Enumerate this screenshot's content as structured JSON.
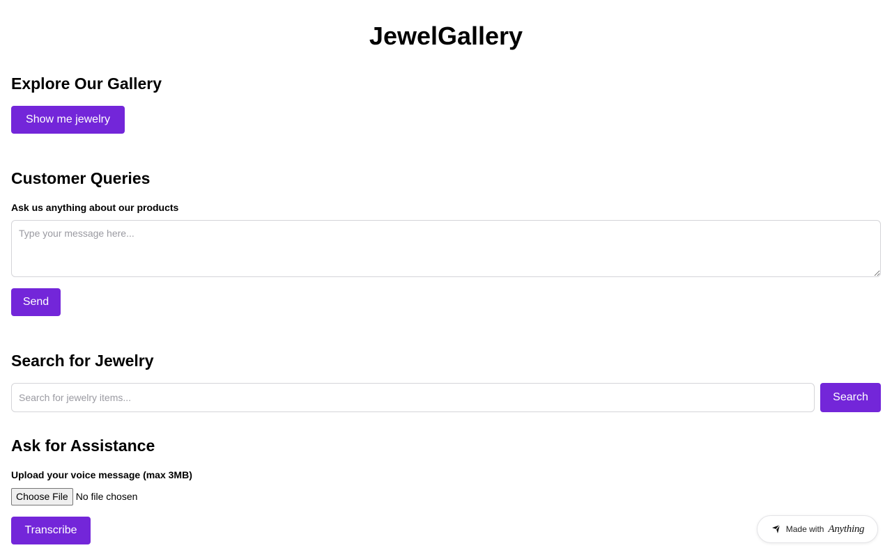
{
  "header": {
    "title": "JewelGallery"
  },
  "gallery": {
    "title": "Explore Our Gallery",
    "button_label": "Show me jewelry"
  },
  "queries": {
    "title": "Customer Queries",
    "label": "Ask us anything about our products",
    "placeholder": "Type your message here...",
    "send_label": "Send"
  },
  "search": {
    "title": "Search for Jewelry",
    "placeholder": "Search for jewelry items...",
    "button_label": "Search"
  },
  "assistance": {
    "title": "Ask for Assistance",
    "label": "Upload your voice message (max 3MB)",
    "choose_file_label": "Choose File",
    "file_status": "No file chosen",
    "transcribe_label": "Transcribe"
  },
  "badge": {
    "prefix": "Made with",
    "brand": "Anything",
    "icon": "anything-logo-icon"
  },
  "colors": {
    "accent": "#7326d9"
  }
}
